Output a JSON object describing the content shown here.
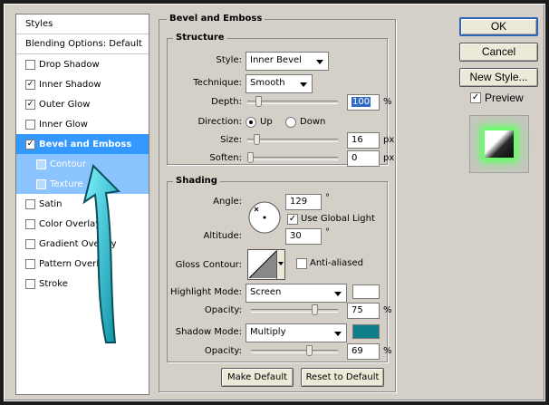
{
  "styles_panel": {
    "header": "Styles",
    "blending_options": "Blending Options: Default",
    "items": [
      {
        "label": "Drop Shadow",
        "checked": false
      },
      {
        "label": "Inner Shadow",
        "checked": true
      },
      {
        "label": "Outer Glow",
        "checked": true
      },
      {
        "label": "Inner Glow",
        "checked": false
      },
      {
        "label": "Bevel and Emboss",
        "checked": true,
        "selected": true
      },
      {
        "label": "Contour",
        "checked": false,
        "sub": true
      },
      {
        "label": "Texture",
        "checked": false,
        "sub": true
      },
      {
        "label": "Satin",
        "checked": false
      },
      {
        "label": "Color Overlay",
        "checked": false
      },
      {
        "label": "Gradient Overlay",
        "checked": false
      },
      {
        "label": "Pattern Overlay",
        "checked": false
      },
      {
        "label": "Stroke",
        "checked": false
      }
    ]
  },
  "bevel": {
    "title": "Bevel and Emboss",
    "structure": {
      "title": "Structure",
      "style_label": "Style:",
      "style_value": "Inner Bevel",
      "technique_label": "Technique:",
      "technique_value": "Smooth",
      "depth_label": "Depth:",
      "depth_value": "100",
      "depth_unit": "%",
      "depth_fraction": 0.1,
      "direction_label": "Direction:",
      "direction_up": "Up",
      "direction_down": "Down",
      "direction_selected": "Up",
      "size_label": "Size:",
      "size_value": "16",
      "size_unit": "px",
      "size_fraction": 0.07,
      "soften_label": "Soften:",
      "soften_value": "0",
      "soften_unit": "px",
      "soften_fraction": 0.0
    },
    "shading": {
      "title": "Shading",
      "angle_label": "Angle:",
      "angle_value": "129",
      "angle_unit": "°",
      "use_global_light": "Use Global Light",
      "use_global_light_checked": true,
      "altitude_label": "Altitude:",
      "altitude_value": "30",
      "altitude_unit": "°",
      "gloss_contour_label": "Gloss Contour:",
      "anti_aliased": "Anti-aliased",
      "anti_aliased_checked": false,
      "highlight_mode_label": "Highlight Mode:",
      "highlight_mode_value": "Screen",
      "highlight_color": "#ffffff",
      "highlight_opacity_label": "Opacity:",
      "highlight_opacity_value": "75",
      "highlight_opacity_unit": "%",
      "highlight_opacity_fraction": 0.75,
      "shadow_mode_label": "Shadow Mode:",
      "shadow_mode_value": "Multiply",
      "shadow_color": "#0f7f8a",
      "shadow_opacity_label": "Opacity:",
      "shadow_opacity_value": "69",
      "shadow_opacity_unit": "%",
      "shadow_opacity_fraction": 0.69
    },
    "make_default": "Make Default",
    "reset_to_default": "Reset to Default"
  },
  "actions": {
    "ok": "OK",
    "cancel": "Cancel",
    "new_style": "New Style...",
    "preview": "Preview",
    "preview_checked": true
  },
  "colors": {
    "selection": "#3399ff",
    "arrow": "#27c6d8",
    "glow": "#66ff66"
  }
}
